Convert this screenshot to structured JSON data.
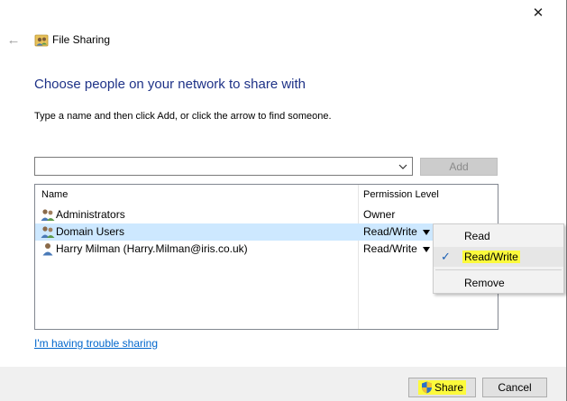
{
  "window": {
    "title": "File Sharing",
    "close_glyph": "✕",
    "back_glyph": "←"
  },
  "heading": "Choose people on your network to share with",
  "instructions": "Type a name and then click Add, or click the arrow to find someone.",
  "name_field": {
    "value": "",
    "placeholder": ""
  },
  "add_button": "Add",
  "table": {
    "columns": [
      "Name",
      "Permission Level"
    ],
    "rows": [
      {
        "name": "Administrators",
        "permission": "Owner",
        "icon": "group-users-icon"
      },
      {
        "name": "Domain Users",
        "permission": "Read/Write",
        "icon": "group-users-icon",
        "selected": true
      },
      {
        "name": "Harry Milman (Harry.Milman@iris.co.uk)",
        "permission": "Read/Write",
        "icon": "single-user-icon"
      }
    ]
  },
  "permission_menu": {
    "items": [
      "Read",
      "Read/Write",
      "Remove"
    ],
    "checked": "Read/Write"
  },
  "trouble_link": "I'm having trouble sharing",
  "buttons": {
    "share": "Share",
    "cancel": "Cancel"
  },
  "colors": {
    "heading": "#1e3287",
    "link": "#0066cc",
    "selected_row": "#cde8ff",
    "highlight": "#fcfa3c"
  }
}
